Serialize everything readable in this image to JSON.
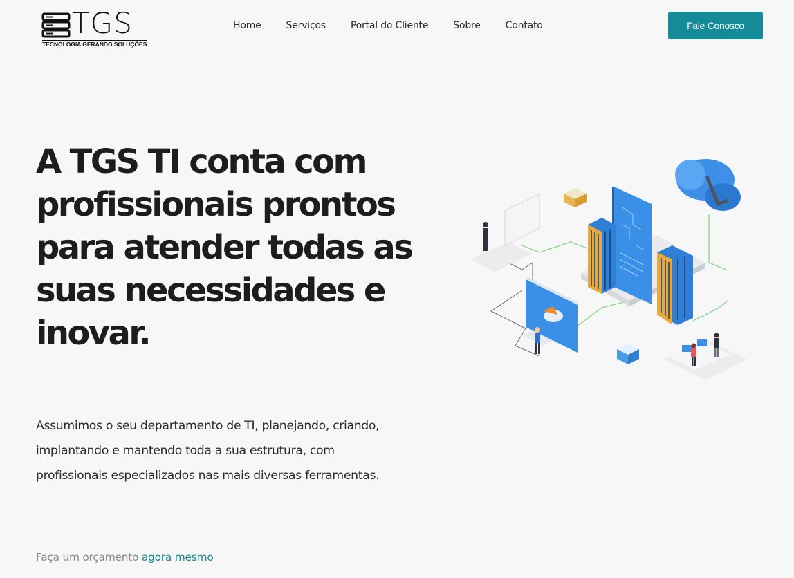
{
  "brand": {
    "name": "TGS",
    "tagline": "TECNOLOGIA GERANDO SOLUÇÕES",
    "icon": "server-stack-icon"
  },
  "nav": {
    "items": [
      {
        "label": "Home"
      },
      {
        "label": "Serviços"
      },
      {
        "label": "Portal do Cliente"
      },
      {
        "label": "Sobre"
      },
      {
        "label": "Contato"
      }
    ]
  },
  "header": {
    "cta_label": "Fale Conosco"
  },
  "hero": {
    "headline": "A TGS TI conta com profissionais prontos para atender todas as suas necessidades e inovar.",
    "description": "Assumimos o seu departamento de TI, planejando, criando, implantando e mantendo toda a sua estrutura, com profissionais especializados nas mais diversas ferramentas.",
    "quote_prefix": "Faça um orçamento",
    "quote_link": "agora mesmo",
    "illustration": "isometric-it-infrastructure-illustration"
  },
  "colors": {
    "accent": "#158b9a",
    "background": "#f7f7f7",
    "text": "#1d1d1d"
  }
}
